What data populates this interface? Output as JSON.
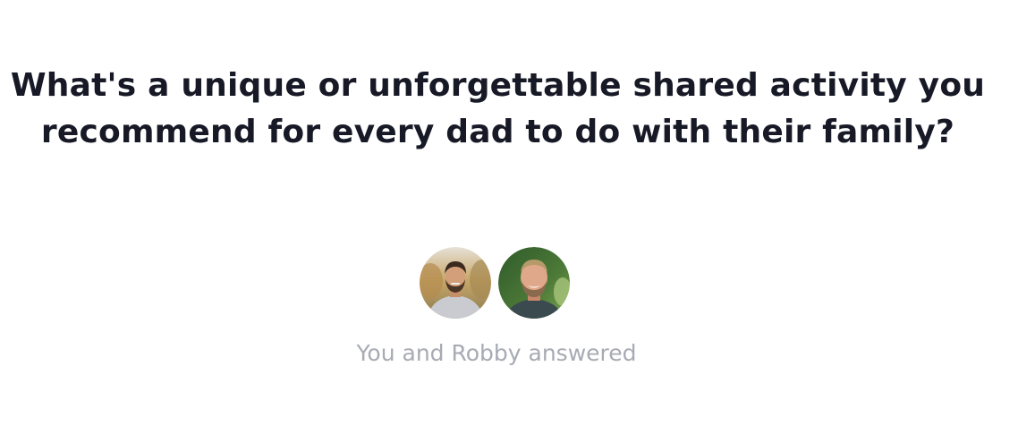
{
  "question": {
    "line1": "What's a unique or unforgettable shared activity you",
    "line2": "recommend for every dad to do with their family?"
  },
  "responders": {
    "avatars": [
      {
        "name": "You",
        "icon": "avatar-photo"
      },
      {
        "name": "Robby",
        "icon": "avatar-photo"
      }
    ],
    "summary": "You and Robby answered"
  }
}
